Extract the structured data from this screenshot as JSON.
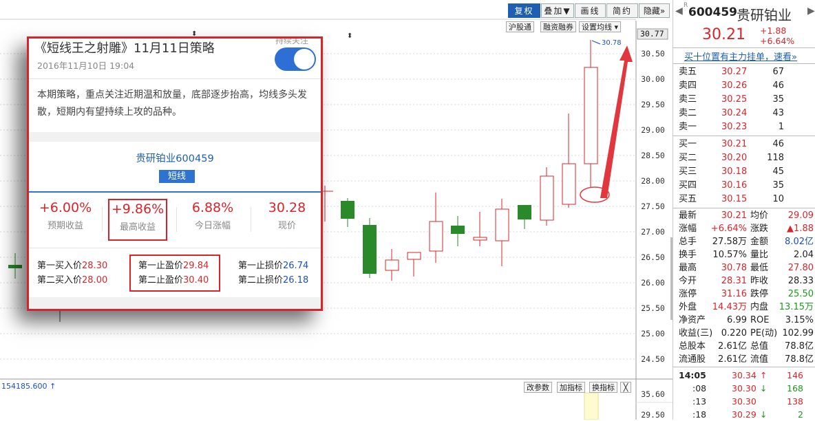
{
  "toolbar": {
    "fuquan": "复权",
    "diejia": "叠加▼",
    "huaxian": "画线",
    "jianyue": "简约",
    "yincang": "隐藏»",
    "hugutong": "沪股通",
    "rongzi": "融资融券",
    "junxian": "设置均线"
  },
  "chart": {
    "price_label": "30.77",
    "high_annotation": "30.78",
    "yticks": [
      "30.50",
      "30.00",
      "29.50",
      "29.00",
      "28.50",
      "28.00",
      "27.50",
      "27.00",
      "26.50",
      "26.00",
      "25.50",
      "25.00",
      "24.50"
    ],
    "volume_readout": "154185.600 ↑",
    "vol_yticks": [
      "35.60",
      "29.50"
    ],
    "buttons": {
      "gai": "改参数",
      "jia": "加指标",
      "huan": "换指标",
      "close": "╳"
    }
  },
  "popup": {
    "title": "《短线王之射雕》11月11日策略",
    "date": "2016年11月10日 19:04",
    "follow": "持续关注",
    "desc": "本期策略，重点关注近期温和放量，底部逐步抬高，均线多头发散，短期内有望持续上攻的品种。",
    "stock": "贵研铂业600459",
    "tag": "短线",
    "stats": [
      {
        "value": "+6.00%",
        "label": "预期收益"
      },
      {
        "value": "+9.86%",
        "label": "最高收益"
      },
      {
        "value": "6.88%",
        "label": "今日涨幅"
      },
      {
        "value": "30.28",
        "label": "现价"
      }
    ],
    "buy1_label": "第一买入价",
    "buy1": "28.30",
    "buy2_label": "第二买入价",
    "buy2": "28.00",
    "tp1_label": "第一止盈价",
    "tp1": "29.84",
    "tp2_label": "第二止盈价",
    "tp2": "30.40",
    "sl1_label": "第一止损价",
    "sl1": "26.74",
    "sl2_label": "第二止损价",
    "sl2": "26.18"
  },
  "quote": {
    "code": "600459",
    "name": "贵研铂业",
    "r_mark": "R",
    "price": "30.21",
    "change": "+1.88",
    "change_pct": "+6.64%",
    "banner": "买十位置有主力挂单，速看»",
    "asks": [
      {
        "label": "卖五",
        "price": "30.27",
        "vol": "67"
      },
      {
        "label": "卖四",
        "price": "30.26",
        "vol": "46"
      },
      {
        "label": "卖三",
        "price": "30.25",
        "vol": "35"
      },
      {
        "label": "卖二",
        "price": "30.24",
        "vol": "43"
      },
      {
        "label": "卖一",
        "price": "30.23",
        "vol": "1"
      }
    ],
    "bids": [
      {
        "label": "买一",
        "price": "30.21",
        "vol": "46"
      },
      {
        "label": "买二",
        "price": "30.20",
        "vol": "118"
      },
      {
        "label": "买三",
        "price": "30.18",
        "vol": "45"
      },
      {
        "label": "买四",
        "price": "30.16",
        "vol": "35"
      },
      {
        "label": "买五",
        "price": "30.15",
        "vol": "10"
      }
    ],
    "stats": [
      {
        "l1": "最新",
        "v1": "30.21",
        "l2": "均价",
        "v2": "29.09"
      },
      {
        "l1": "涨幅",
        "v1": "+6.64%",
        "l2": "涨跌",
        "v2": "▲1.88"
      },
      {
        "l1": "总手",
        "v1": "27.58万",
        "l2": "金额",
        "v2": "8.02亿"
      },
      {
        "l1": "换手",
        "v1": "10.57%",
        "l2": "量比",
        "v2": "2.04"
      },
      {
        "l1": "最高",
        "v1": "30.78",
        "l2": "最低",
        "v2": "27.80"
      },
      {
        "l1": "今开",
        "v1": "28.31",
        "l2": "昨收",
        "v2": "28.33"
      },
      {
        "l1": "涨停",
        "v1": "31.16",
        "l2": "跌停",
        "v2": "25.50"
      },
      {
        "l1": "外盘",
        "v1": "14.43万",
        "l2": "内盘",
        "v2": "13.15万"
      },
      {
        "l1": "净资产",
        "v1": "6.99",
        "l2": "ROE",
        "v2": "3.15%"
      },
      {
        "l1": "收益(三)",
        "v1": "0.220",
        "l2": "PE(动)",
        "v2": "102.99"
      },
      {
        "l1": "总股本",
        "v1": "2.61亿",
        "l2": "总值",
        "v2": "78.8亿"
      },
      {
        "l1": "流通股",
        "v1": "2.61亿",
        "l2": "流值",
        "v2": "78.8亿"
      }
    ],
    "ticks": [
      {
        "time": "14:05",
        "price": "30.34",
        "arrow": "↑",
        "vol": "146"
      },
      {
        "time": ":08",
        "price": "30.30",
        "arrow": "↓",
        "vol": "168"
      },
      {
        "time": ":13",
        "price": "30.30",
        "arrow": "",
        "vol": "138"
      },
      {
        "time": ":18",
        "price": "30.29",
        "arrow": "↓",
        "vol": "2"
      }
    ]
  },
  "colors": {
    "up": "#d9252a",
    "down": "#2a8a2a",
    "highlight": "#d8232a",
    "brand_blue": "#1e5fb4"
  }
}
